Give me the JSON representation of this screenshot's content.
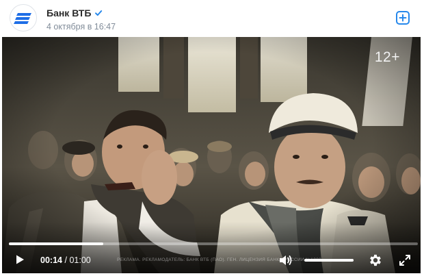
{
  "post": {
    "author": "Банк ВТБ",
    "date": "4 октября в 16:47"
  },
  "video": {
    "age_rating": "12+",
    "watermark": "РЕКЛАМА. РЕКЛАМОДАТЕЛЬ: БАНК ВТБ (ПАО). ГЕН. ЛИЦЕНЗИЯ БАНКА РОССИИ №1000",
    "current_time": "00:14",
    "time_separator": "/",
    "duration": "01:00",
    "progress": 0.23,
    "volume": 1.0
  },
  "colors": {
    "accent": "#2688eb",
    "brand": "#0a2896"
  }
}
